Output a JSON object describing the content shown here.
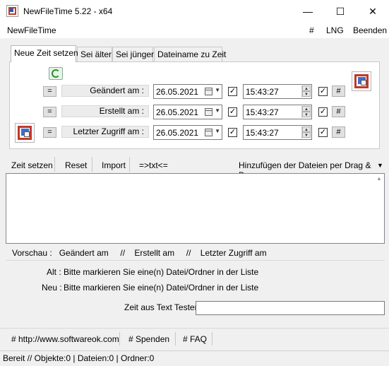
{
  "window": {
    "title": "NewFileTime 5.22 - x64",
    "minimize": "—",
    "maximize": "☐",
    "close": "✕"
  },
  "menu": {
    "left": "NewFileTime",
    "hash": "#",
    "lng": "LNG",
    "exit": "Beenden"
  },
  "tabs": [
    {
      "label": "Neue Zeit setzen",
      "active": true
    },
    {
      "label": "Sei älter"
    },
    {
      "label": "Sei jünger"
    },
    {
      "label": "Dateiname zu Zeit"
    }
  ],
  "rows": [
    {
      "eq": "=",
      "label": "Geändert am :",
      "date": "26.05.2021",
      "time": "15:43:27",
      "checked": true,
      "hash": "#"
    },
    {
      "eq": "=",
      "label": "Erstellt am :",
      "date": "26.05.2021",
      "time": "15:43:27",
      "checked": true,
      "hash": "#"
    },
    {
      "eq": "=",
      "label": "Letzter Zugriff am :",
      "date": "26.05.2021",
      "time": "15:43:27",
      "checked": true,
      "hash": "#"
    }
  ],
  "checkmark": "✓",
  "toolbar": {
    "set_time": "Zeit setzen",
    "reset": "Reset",
    "import": "Import",
    "txt": "=>txt<=",
    "drag_drop": "Hinzufügen der Dateien per Drag & Drop",
    "dropdown_arrow": "▼"
  },
  "list_scroll_arrow": "▲",
  "preview": {
    "header": "Vorschau :   Geändert am     //    Erstellt am     //    Letzter Zugriff am",
    "old_label": "Alt :",
    "old_text": "Bitte markieren Sie eine(n) Datei/Ordner in der Liste",
    "new_label": "Neu :",
    "new_text": "Bitte markieren Sie eine(n) Datei/Ordner in der Liste",
    "tester_label": "Zeit aus Text Tester",
    "tester_value": ""
  },
  "links": [
    "# http://www.softwareok.com",
    "# Spenden",
    "# FAQ"
  ],
  "status": "Bereit // Objekte:0 | Dateien:0  | Ordner:0"
}
